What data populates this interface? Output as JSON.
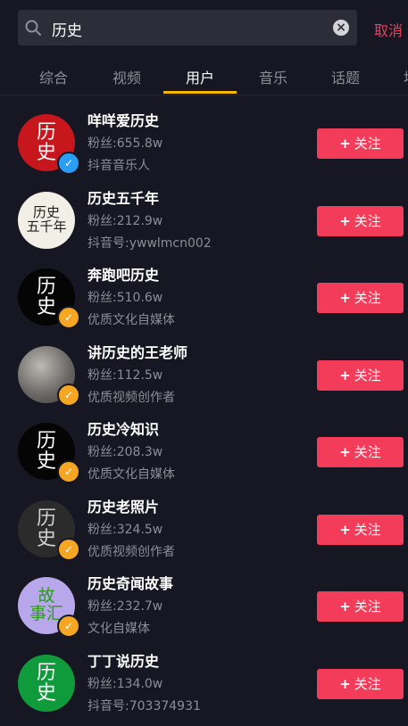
{
  "search": {
    "query": "历史",
    "cancel_label": "取消"
  },
  "tabs": [
    {
      "label": "综合"
    },
    {
      "label": "视频"
    },
    {
      "label": "用户"
    },
    {
      "label": "音乐"
    },
    {
      "label": "话题"
    },
    {
      "label": "地"
    }
  ],
  "active_tab": "用户",
  "follow_label": "关注",
  "users": [
    {
      "name": "咩咩爱历史",
      "fans": "粉丝:655.8w",
      "desc": "抖音音乐人",
      "avatar_text": "历史",
      "avatar_bg": "#c8161d",
      "avatar_fg": "#ffffff",
      "verified": "blue"
    },
    {
      "name": "历史五千年",
      "fans": "粉丝:212.9w",
      "desc": "抖音号:ywwlmcn002",
      "avatar_text": "历史五千年",
      "avatar_bg": "#f2efe6",
      "avatar_fg": "#222222",
      "verified": ""
    },
    {
      "name": "奔跑吧历史",
      "fans": "粉丝:510.6w",
      "desc": "优质文化自媒体",
      "avatar_text": "历史",
      "avatar_bg": "#050505",
      "avatar_fg": "#ffffff",
      "verified": "gold"
    },
    {
      "name": "讲历史的王老师",
      "fans": "粉丝:112.5w",
      "desc": "优质视频创作者",
      "avatar_text": "",
      "avatar_bg": "#7d7b78",
      "avatar_fg": "#ffffff",
      "verified": "gold"
    },
    {
      "name": "历史冷知识",
      "fans": "粉丝:208.3w",
      "desc": "优质文化自媒体",
      "avatar_text": "历史",
      "avatar_bg": "#050505",
      "avatar_fg": "#ffffff",
      "verified": "gold"
    },
    {
      "name": "历史老照片",
      "fans": "粉丝:324.5w",
      "desc": "优质视频创作者",
      "avatar_text": "历史",
      "avatar_bg": "#2b2b2b",
      "avatar_fg": "#d0d0d0",
      "verified": "gold"
    },
    {
      "name": "历史奇闻故事",
      "fans": "粉丝:232.7w",
      "desc": "文化自媒体",
      "avatar_text": "故事汇",
      "avatar_bg": "#b9a7ec",
      "avatar_fg": "#2f9a1f",
      "verified": "gold"
    },
    {
      "name": "丁丁说历史",
      "fans": "粉丝:134.0w",
      "desc": "抖音号:703374931",
      "avatar_text": "历史",
      "avatar_bg": "#0f9a3c",
      "avatar_fg": "#ffffff",
      "verified": ""
    }
  ],
  "colors": {
    "accent": "#f33b5a",
    "tab_indicator": "#f5b700",
    "badge_blue": "#2a9df4",
    "badge_gold": "#f5a623"
  },
  "icons": {
    "search": "search-icon",
    "clear": "clear-icon",
    "verified": "checkmark-icon",
    "plus": "plus-icon"
  }
}
